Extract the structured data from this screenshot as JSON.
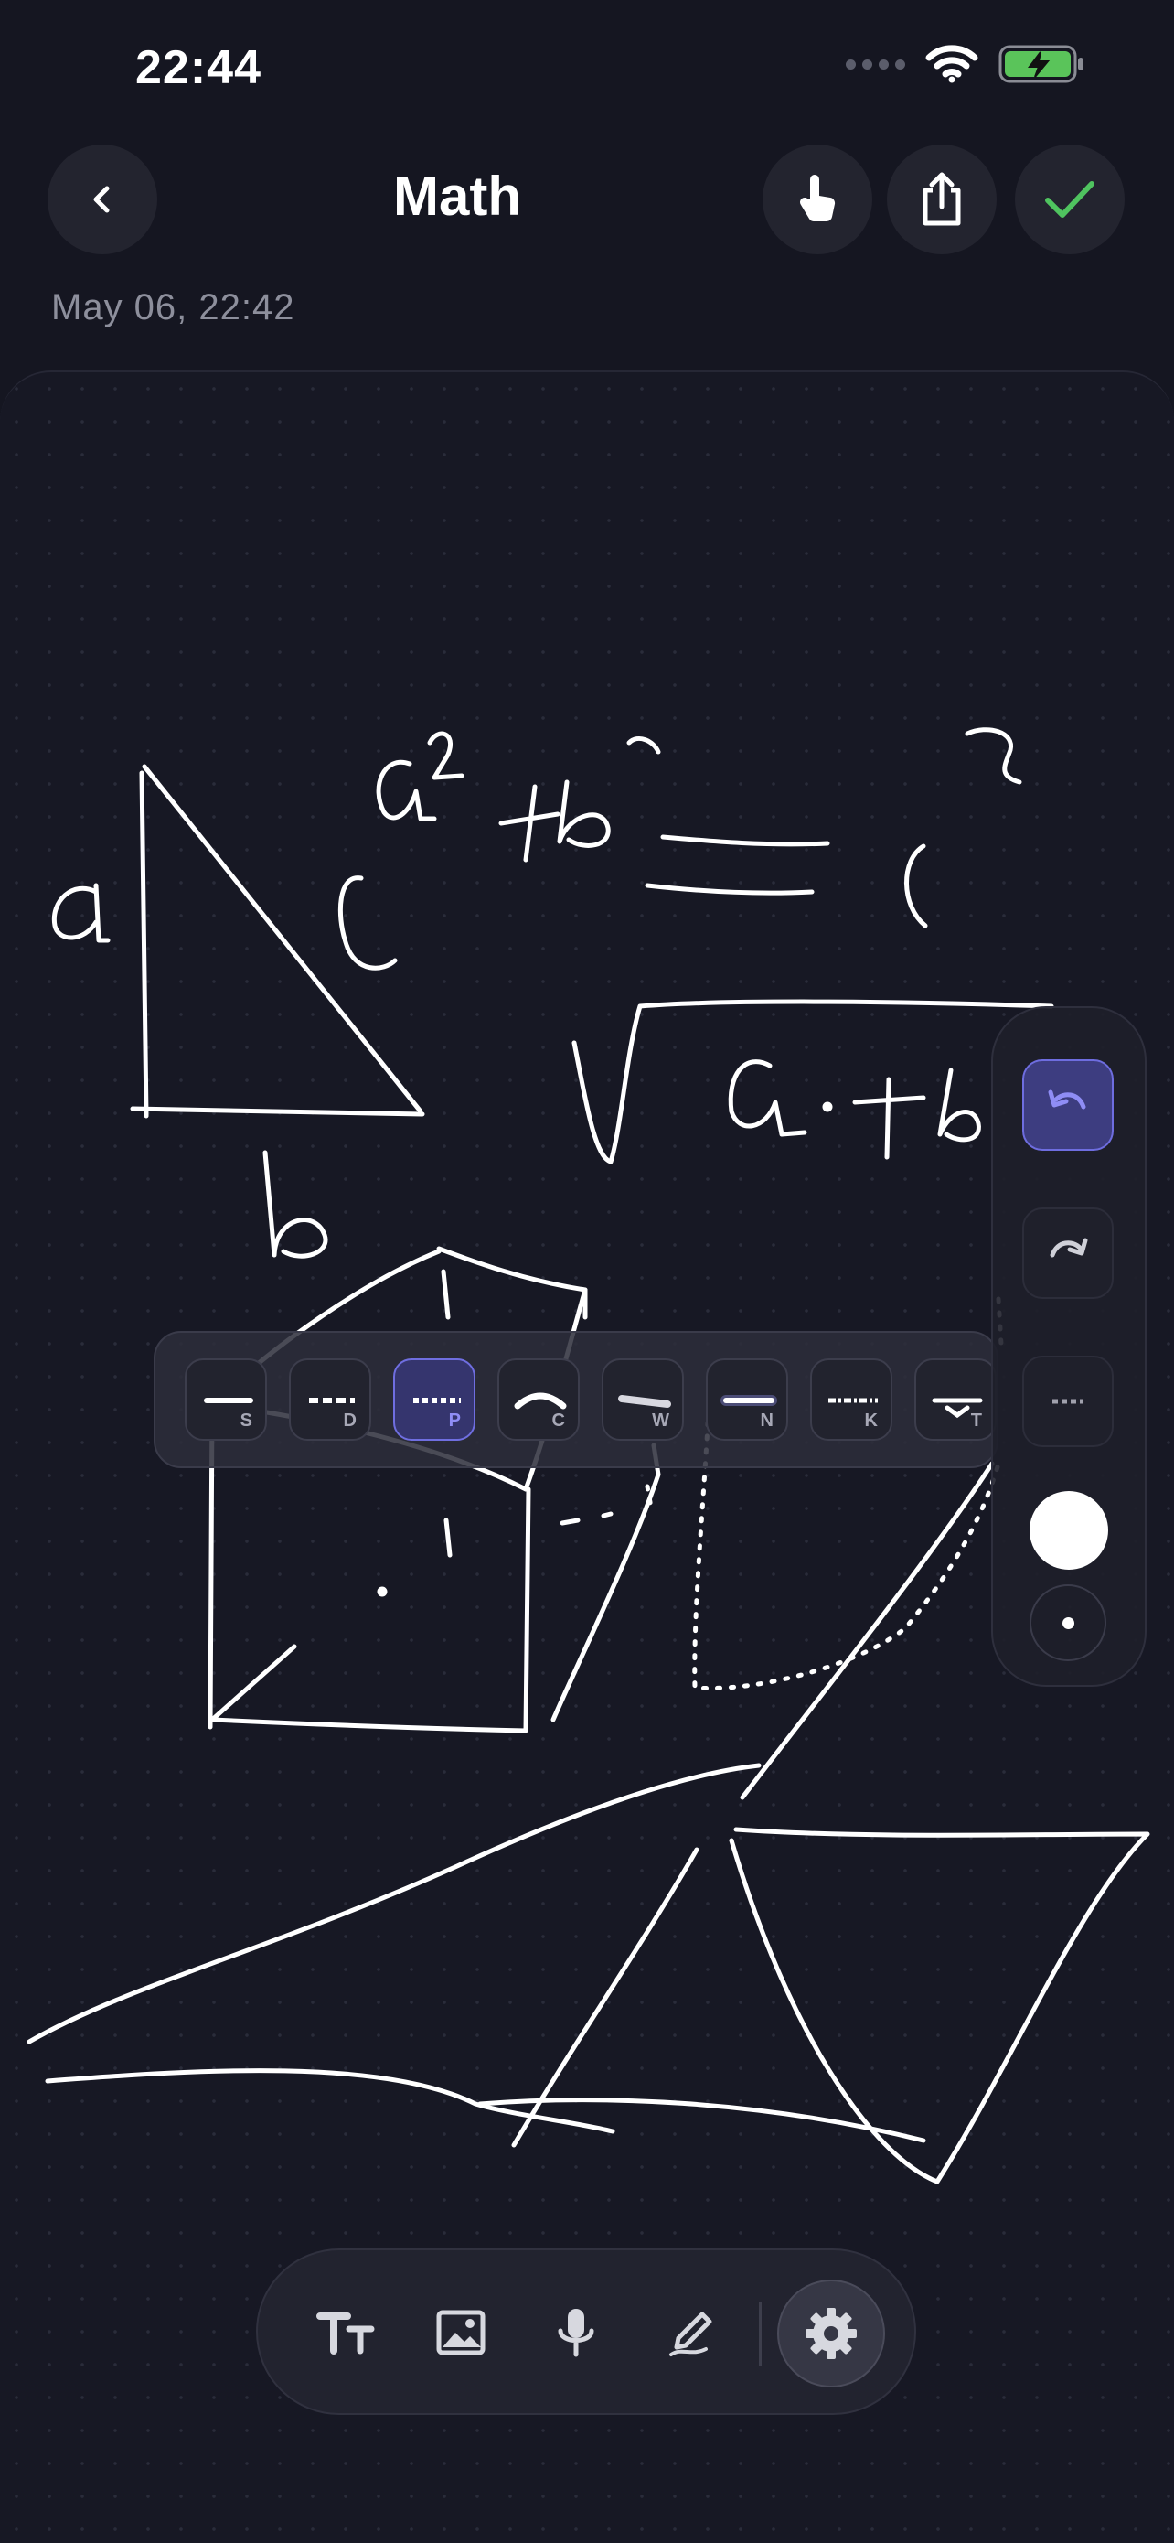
{
  "status_bar": {
    "time": "22:44"
  },
  "header": {
    "title": "Math",
    "date": "May 06, 22:42",
    "back_icon": "chevron-left-icon",
    "actions": [
      "hand-touch-icon",
      "share-icon",
      "check-icon"
    ]
  },
  "stroke_styles": [
    {
      "letter": "S",
      "selected": false
    },
    {
      "letter": "D",
      "selected": false
    },
    {
      "letter": "P",
      "selected": true
    },
    {
      "letter": "C",
      "selected": false
    },
    {
      "letter": "W",
      "selected": false
    },
    {
      "letter": "N",
      "selected": false
    },
    {
      "letter": "K",
      "selected": false
    },
    {
      "letter": "T",
      "selected": false
    }
  ],
  "side_panel": {
    "undo_icon": "undo-icon",
    "redo_icon": "redo-icon",
    "stroke_style_icon": "dash-line-icon",
    "pen_color": "#ffffff",
    "size_icon": "small-dot-icon"
  },
  "bottom_toolbar": {
    "tools": [
      "text-icon",
      "image-icon",
      "microphone-icon",
      "pen-icon"
    ],
    "settings_icon": "gear-icon"
  },
  "colors": {
    "background": "#151621",
    "accent": "#6e6ddf",
    "check": "#4fc35f",
    "battery": "#5ac45a"
  }
}
